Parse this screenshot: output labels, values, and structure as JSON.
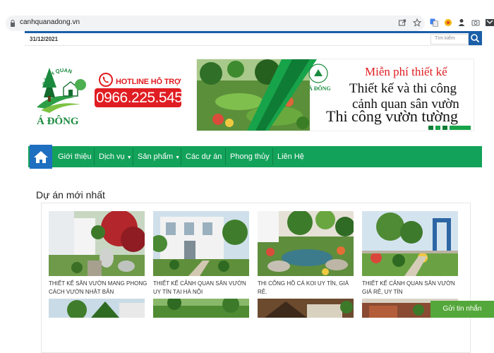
{
  "browser": {
    "url": "canhquanadong.vn"
  },
  "topbar": {
    "date": "31/12/2021",
    "search_placeholder": "Tìm kiếm"
  },
  "logo": {
    "brand": "Á ĐÔNG",
    "arc_text": "CẢNH QUAN"
  },
  "hotline": {
    "label": "HOTLINE HỖ TRỢ",
    "phone": "0966.225.545"
  },
  "banner": {
    "line1": "Miễn phí thiết kế",
    "line2": "Thiết kế và thi công",
    "line3": "cảnh quan sân vườn",
    "line4": "Thi công vườn tường",
    "mini_brand": "Á ĐÔNG"
  },
  "nav": {
    "items": [
      {
        "label": "Giới thiệu"
      },
      {
        "label": "Dịch vụ",
        "dropdown": true
      },
      {
        "label": "Sản phẩm",
        "dropdown": true
      },
      {
        "label": "Các dự án"
      },
      {
        "label": "Phong thủy"
      },
      {
        "label": "Liên Hệ"
      }
    ]
  },
  "projects": {
    "title": "Dự án mới nhất",
    "cards": [
      {
        "caption": "THIẾT KẾ SÂN VƯỜN MANG PHONG CÁCH VƯỜN NHẬT BẢN"
      },
      {
        "caption": "THIẾT KẾ CẢNH QUAN SÂN VƯỜN UY TÍN TẠI HÀ NỘI"
      },
      {
        "caption": "THI CÔNG HỒ CÁ KOI UY TÍN, GIÁ RẺ."
      },
      {
        "caption": "THIẾT KẾ CẢNH QUAN SÂN VƯỜN GIÁ RẺ, UY TÍN"
      }
    ]
  },
  "chat": {
    "label": "Gửi tin nhắn"
  },
  "colors": {
    "nav_green": "#13a25a",
    "home_blue": "#1f6fc0",
    "hotline_red": "#e01d22",
    "chat_green": "#54a73a"
  }
}
